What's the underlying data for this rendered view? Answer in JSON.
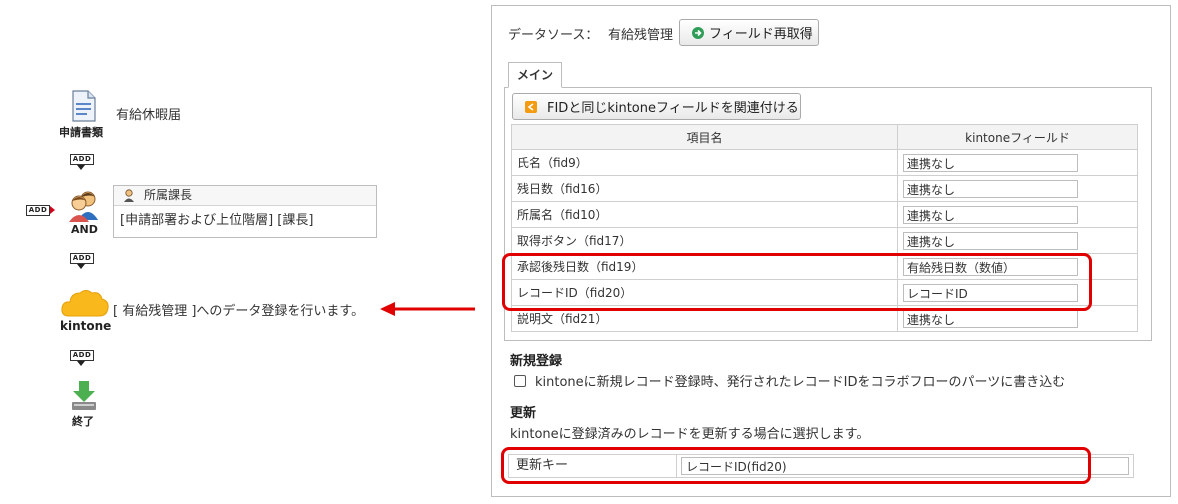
{
  "flow": {
    "document": {
      "label": "申請書類",
      "name": "有給休暇届"
    },
    "add_badge": "ADD",
    "and_label": "AND",
    "approver": {
      "role": "所属課長",
      "condition": "[申請部署および上位階層] [課長]"
    },
    "kintone": {
      "label": "kintone",
      "description": "[ 有給残管理 ]へのデータ登録を行います。"
    },
    "end_label": "終了"
  },
  "panel": {
    "datasource_label": "データソース：",
    "datasource_name": "有給残管理",
    "refresh_button": "フィールド再取得",
    "tab_main": "メイン",
    "link_button": "FIDと同じkintoneフィールドを関連付ける",
    "table": {
      "col_item": "項目名",
      "col_field": "kintoneフィールド",
      "rows": [
        {
          "item": "氏名（fid9）",
          "field": "連携なし"
        },
        {
          "item": "残日数（fid16）",
          "field": "連携なし"
        },
        {
          "item": "所属名（fid10）",
          "field": "連携なし"
        },
        {
          "item": "取得ボタン（fid17）",
          "field": "連携なし"
        },
        {
          "item": "承認後残日数（fid19）",
          "field": "有給残日数（数値）"
        },
        {
          "item": "レコードID（fid20）",
          "field": "レコードID"
        },
        {
          "item": "説明文（fid21）",
          "field": "連携なし"
        }
      ]
    },
    "new_section": {
      "title": "新規登録",
      "checkbox_label": "kintoneに新規レコード登録時、発行されたレコードIDをコラボフローのパーツに書き込む",
      "checked": false
    },
    "update_section": {
      "title": "更新",
      "description": "kintoneに登録済みのレコードを更新する場合に選択します。",
      "key_label": "更新キー",
      "key_value": "レコードID(fid20)"
    }
  },
  "colors": {
    "highlight": "#e00000",
    "kintone": "#f9b81b",
    "go_icon": "#2e9d57",
    "link_icon": "#f39c12"
  }
}
